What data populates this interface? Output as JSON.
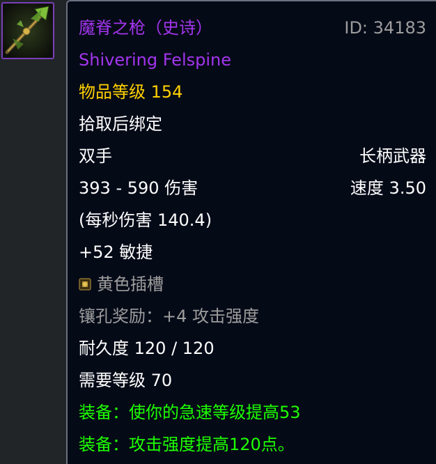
{
  "item": {
    "name_cn": "魔脊之枪（史诗）",
    "name_en": "Shivering Felspine",
    "id_label": "ID: 34183",
    "item_level": "物品等级 154",
    "bind": "拾取后绑定",
    "slot": "双手",
    "type": "长柄武器",
    "damage": "393 - 590 伤害",
    "speed": "速度 3.50",
    "dps": "(每秒伤害 140.4)",
    "stat": "+52 敏捷",
    "socket": "黄色插槽",
    "socket_bonus": "镶孔奖励：+4 攻击强度",
    "durability": "耐久度 120 / 120",
    "required_level": "需要等级 70",
    "equip_1": "装备：使你的急速等级提高53",
    "equip_2": "装备：攻击强度提高120点。"
  },
  "icons": {
    "item_icon": "polearm-icon",
    "socket_icon": "yellow-socket-icon"
  },
  "colors": {
    "epic": "#a335ee",
    "gold": "#ffd100",
    "equip": "#1eff00",
    "muted": "#9d9d9d"
  }
}
